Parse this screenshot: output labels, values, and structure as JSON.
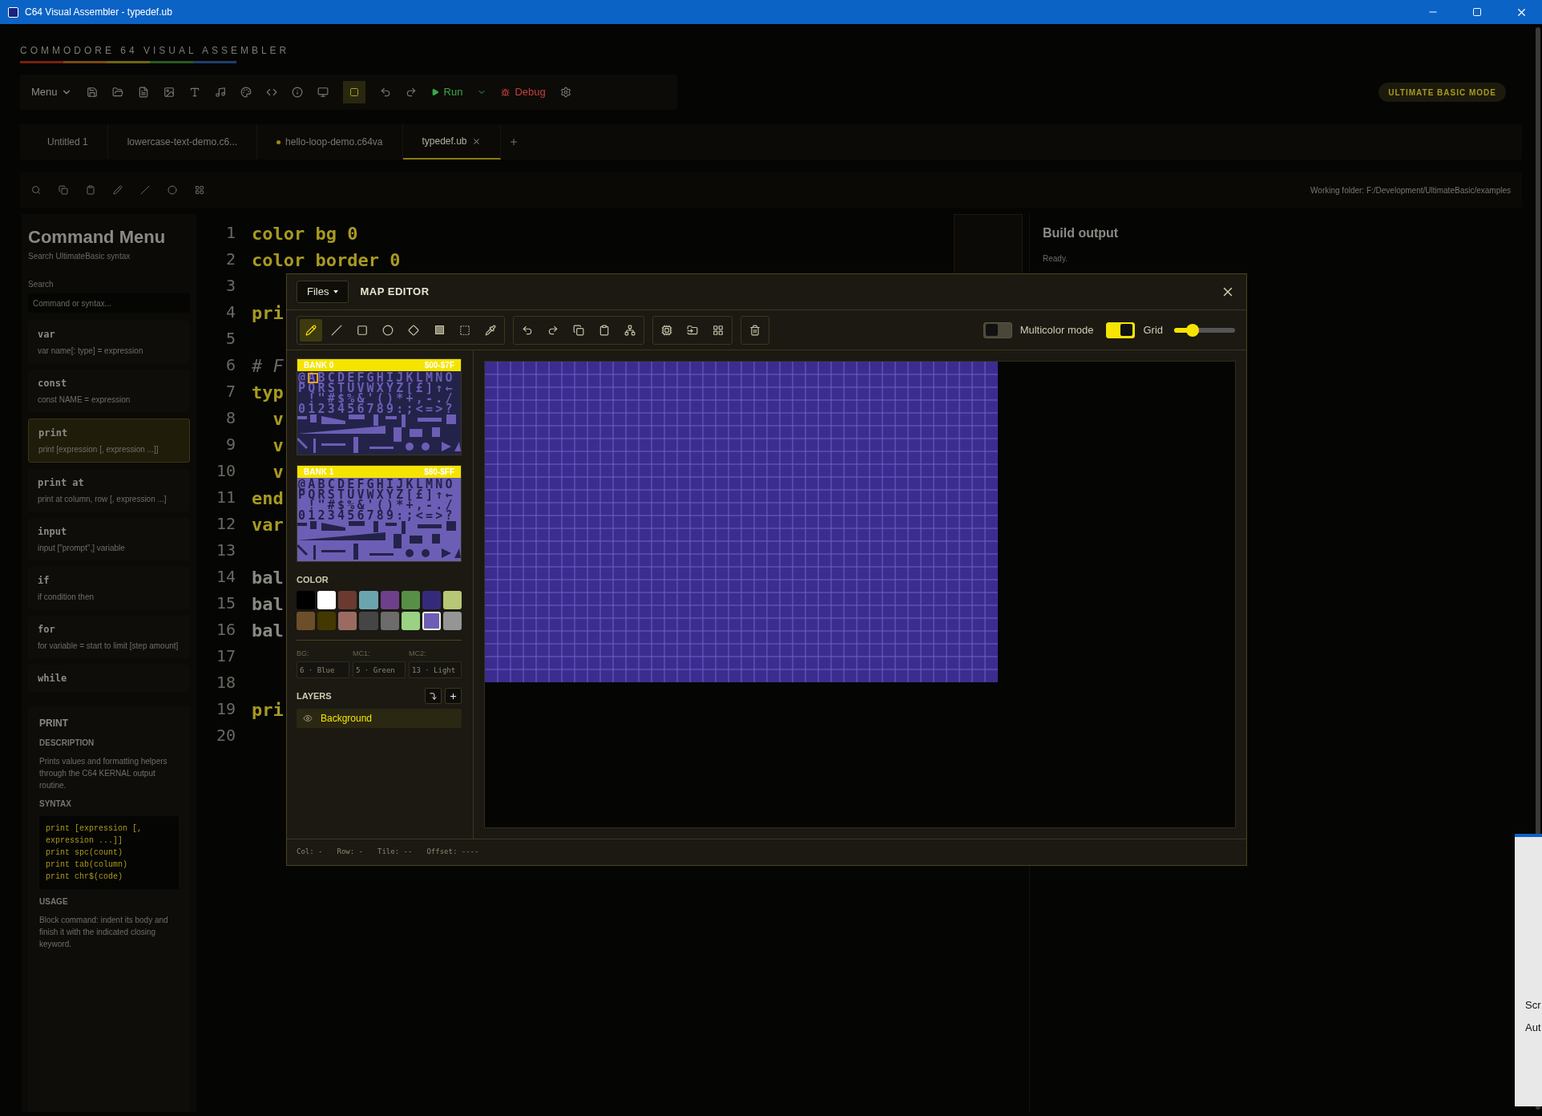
{
  "window": {
    "title": "C64 Visual Assembler - typedef.ub"
  },
  "app": {
    "logo": "COMMODORE 64 VISUAL ASSEMBLER",
    "menu_label": "Menu",
    "run_label": "Run",
    "debug_label": "Debug",
    "mode_badge": "ULTIMATE BASIC MODE",
    "tabs": [
      {
        "label": "Untitled 1",
        "selected": false,
        "modified": false
      },
      {
        "label": "lowercase-text-demo.c6...",
        "selected": false,
        "modified": false
      },
      {
        "label": "hello-loop-demo.c64va",
        "selected": false,
        "modified": true
      },
      {
        "label": "typedef.ub",
        "selected": true,
        "modified": false
      }
    ],
    "working_folder": "Working folder: F:/Development/UltimateBasic/examples"
  },
  "command_menu": {
    "title": "Command Menu",
    "subtitle": "Search UltimateBasic syntax",
    "search_label": "Search",
    "search_placeholder": "Command or syntax...",
    "items": [
      {
        "name": "var",
        "syntax": "var name[: type] = expression",
        "selected": false
      },
      {
        "name": "const",
        "syntax": "const NAME = expression",
        "selected": false
      },
      {
        "name": "print",
        "syntax": "print [expression [, expression ...]]",
        "selected": true
      },
      {
        "name": "print at",
        "syntax": "print at column, row [, expression ...]",
        "selected": false
      },
      {
        "name": "input",
        "syntax": "input [\"prompt\",] variable",
        "selected": false
      },
      {
        "name": "if",
        "syntax": "if condition then",
        "selected": false
      },
      {
        "name": "for",
        "syntax": "for variable = start to limit [step amount]",
        "selected": false
      },
      {
        "name": "while",
        "selected": false
      }
    ],
    "detail": {
      "title": "PRINT",
      "description_heading": "DESCRIPTION",
      "description": "Prints values and formatting helpers through the C64 KERNAL output routine.",
      "syntax_heading": "SYNTAX",
      "syntax_lines": [
        "print [expression [, expression ...]]",
        "print spc(count)",
        "print tab(column)",
        "print chr$(code)"
      ],
      "usage_heading": "USAGE",
      "usage": "Block command: indent its body and finish it with the indicated closing keyword."
    }
  },
  "editor": {
    "lines": [
      {
        "number": "1",
        "text": "color bg 0",
        "kind": "keyword"
      },
      {
        "number": "2",
        "text": "color border 0",
        "kind": "keyword"
      },
      {
        "number": "3"
      },
      {
        "number": "4",
        "text": "pri",
        "kind": "keyword"
      },
      {
        "number": "5"
      },
      {
        "number": "6",
        "text": "# F",
        "kind": "comment"
      },
      {
        "number": "7",
        "text": "typ",
        "kind": "keyword"
      },
      {
        "number": "8",
        "text": "  v",
        "kind": "keyword"
      },
      {
        "number": "9",
        "text": "  v",
        "kind": "keyword"
      },
      {
        "number": "10",
        "text": "  v",
        "kind": "keyword"
      },
      {
        "number": "11",
        "text": "end",
        "kind": "keyword"
      },
      {
        "number": "12",
        "text": "var",
        "kind": "keyword"
      },
      {
        "number": "13"
      },
      {
        "number": "14",
        "text": "bal",
        "kind": "plain"
      },
      {
        "number": "15",
        "text": "bal",
        "kind": "plain"
      },
      {
        "number": "16",
        "text": "bal",
        "kind": "plain"
      },
      {
        "number": "17"
      },
      {
        "number": "18"
      },
      {
        "number": "19",
        "text": "pri",
        "kind": "keyword"
      },
      {
        "number": "20"
      }
    ]
  },
  "build_output": {
    "title": "Build output",
    "status": "Ready."
  },
  "notification": {
    "lines": [
      "Scr",
      "Aut"
    ]
  },
  "map_editor": {
    "files_label": "Files",
    "title": "MAP EDITOR",
    "tool_groups": [
      {
        "tools": [
          {
            "selected": true
          },
          {
            "selected": false
          },
          {
            "selected": false
          },
          {
            "selected": false
          },
          {
            "selected": false
          },
          {
            "selected": false
          },
          {
            "selected": false
          },
          {
            "selected": false
          }
        ]
      },
      {
        "tools": [
          {
            "selected": false
          },
          {
            "selected": false
          },
          {
            "selected": false
          },
          {
            "selected": false
          },
          {
            "selected": false
          }
        ]
      },
      {
        "tools": [
          {
            "selected": false
          },
          {
            "selected": false
          },
          {
            "selected": false
          }
        ]
      },
      {
        "tools": [
          {
            "selected": false
          }
        ]
      }
    ],
    "multicolor": {
      "label": "Multicolor mode",
      "on": false
    },
    "grid": {
      "label": "Grid",
      "on": true
    },
    "zoom_slider": {
      "level": 0.3
    },
    "banks": [
      {
        "label": "BANK 0",
        "range": "$00-$7F",
        "inverted": false,
        "cursor": true,
        "rows": [
          "@ABCDEFGHIJKLMNO",
          "PQRSTUVWXYZ[£]↑←",
          " !\"#$%&'()*+,-./",
          "0123456789:;<=>?"
        ]
      },
      {
        "label": "BANK 1",
        "range": "$80-$FF",
        "inverted": true,
        "cursor": false,
        "rows": [
          "@ABCDEFGHIJKLMNO",
          "PQRSTUVWXYZ[£]↑←",
          " !\"#$%&'()*+,-./",
          "0123456789:;<=>?"
        ]
      }
    ],
    "color_heading": "COLOR",
    "palette": [
      {
        "color": "#000000",
        "selected": false
      },
      {
        "color": "#ffffff",
        "selected": false
      },
      {
        "color": "#6a3a30",
        "selected": false
      },
      {
        "color": "#6ca4ae",
        "selected": false
      },
      {
        "color": "#6e3f8a",
        "selected": false
      },
      {
        "color": "#578f46",
        "selected": false
      },
      {
        "color": "#352a7a",
        "selected": false
      },
      {
        "color": "#b8c775",
        "selected": false
      },
      {
        "color": "#6d4e2b",
        "selected": false
      },
      {
        "color": "#423800",
        "selected": false
      },
      {
        "color": "#9b6b62",
        "selected": false
      },
      {
        "color": "#454545",
        "selected": false
      },
      {
        "color": "#6c6c6c",
        "selected": false
      },
      {
        "color": "#9ad283",
        "selected": false
      },
      {
        "color": "#6c5eb5",
        "selected": true
      },
      {
        "color": "#959595",
        "selected": false
      }
    ],
    "color_fields": [
      {
        "label": "BG:",
        "value": "6 · Blue"
      },
      {
        "label": "MC1:",
        "value": "5 · Green"
      },
      {
        "label": "MC2:",
        "value": "13 · Light"
      }
    ],
    "layers_heading": "LAYERS",
    "layers": [
      {
        "name": "Background",
        "visible": true,
        "selected": true
      }
    ],
    "status": [
      "Col: -",
      "Row: -",
      "Tile: --",
      "Offset: ----"
    ]
  }
}
